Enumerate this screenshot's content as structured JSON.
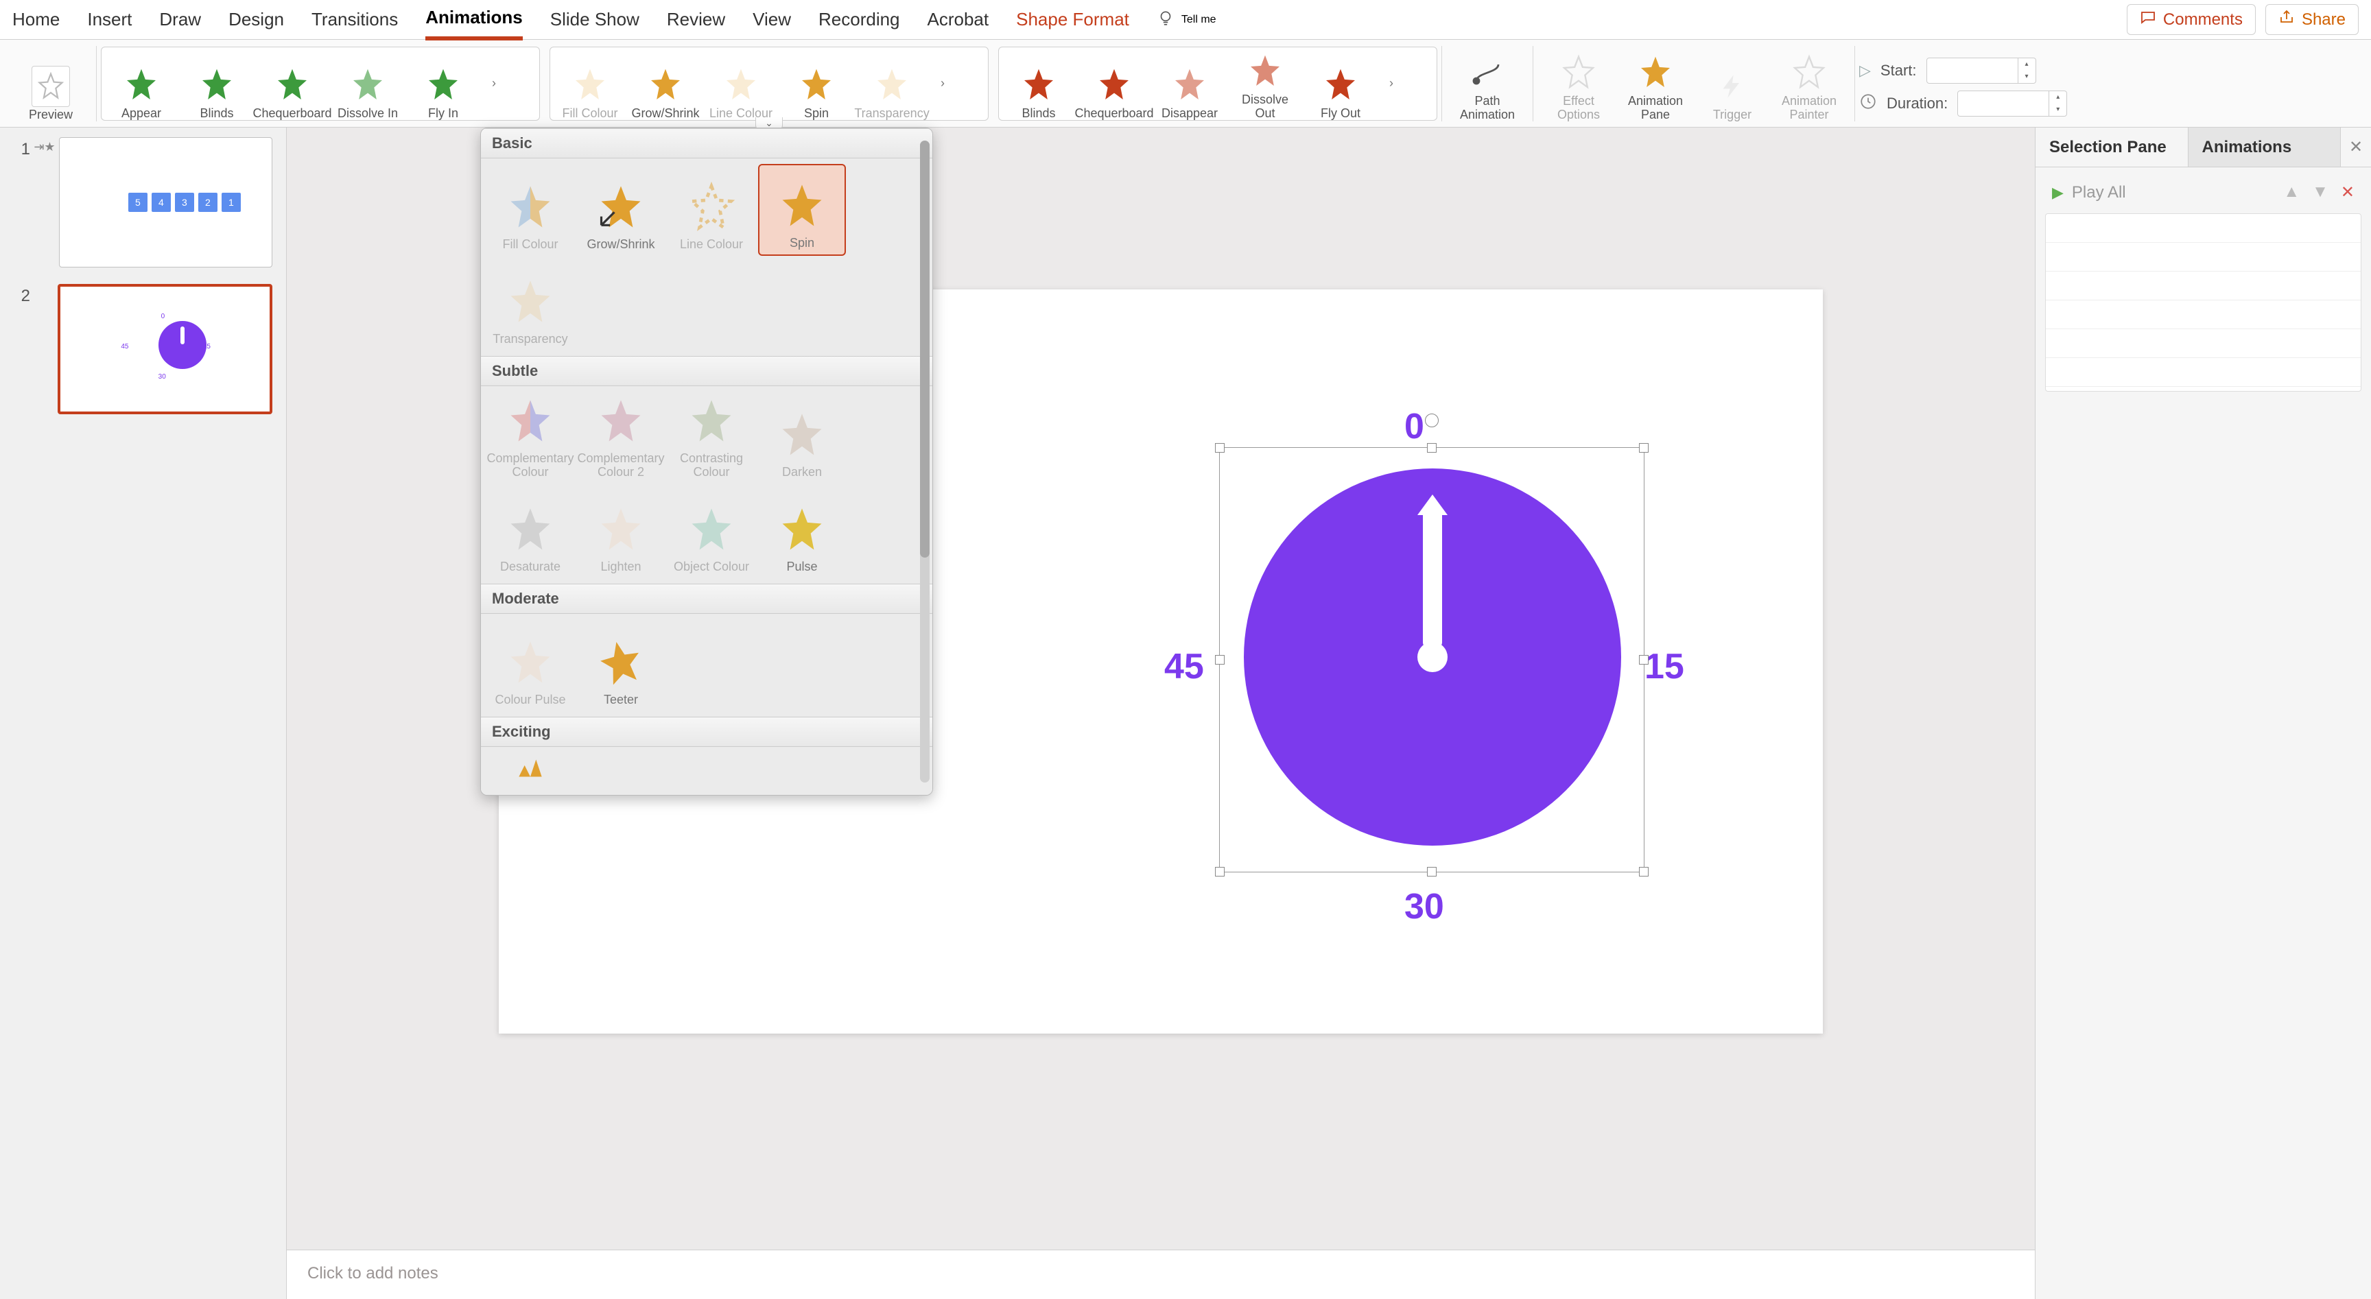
{
  "menu": {
    "tabs": [
      "Home",
      "Insert",
      "Draw",
      "Design",
      "Transitions",
      "Animations",
      "Slide Show",
      "Review",
      "View",
      "Recording",
      "Acrobat",
      "Shape Format"
    ],
    "active": "Animations",
    "tellme": "Tell me",
    "comments": "Comments",
    "share": "Share"
  },
  "ribbon": {
    "preview": "Preview",
    "entrance": [
      {
        "label": "Appear",
        "color": "#3c9a3c"
      },
      {
        "label": "Blinds",
        "color": "#3c9a3c"
      },
      {
        "label": "Chequerboard",
        "color": "#3c9a3c"
      },
      {
        "label": "Dissolve In",
        "color": "#3c9a3c"
      },
      {
        "label": "Fly In",
        "color": "#3c9a3c"
      }
    ],
    "emphasis": [
      {
        "label": "Fill Colour",
        "color": "#e0a030",
        "dim": true
      },
      {
        "label": "Grow/Shrink",
        "color": "#e0a030"
      },
      {
        "label": "Line Colour",
        "color": "#e0a030",
        "dim": true
      },
      {
        "label": "Spin",
        "color": "#e0a030"
      },
      {
        "label": "Transparency",
        "color": "#e0a030",
        "dim": true
      }
    ],
    "exit": [
      {
        "label": "Blinds",
        "color": "#c43e1c"
      },
      {
        "label": "Chequerboard",
        "color": "#c43e1c"
      },
      {
        "label": "Disappear",
        "color": "#c43e1c"
      },
      {
        "label": "Dissolve Out",
        "color": "#c43e1c"
      },
      {
        "label": "Fly Out",
        "color": "#c43e1c"
      }
    ],
    "path_animation": "Path Animation",
    "effect_options": "Effect Options",
    "animation_pane": "Animation Pane",
    "trigger": "Trigger",
    "animation_painter": "Animation Painter",
    "start_label": "Start:",
    "duration_label": "Duration:"
  },
  "dropdown": {
    "sections": {
      "basic": "Basic",
      "subtle": "Subtle",
      "moderate": "Moderate",
      "exciting": "Exciting"
    },
    "basic": [
      {
        "label": "Fill Colour",
        "dim": true
      },
      {
        "label": "Grow/Shrink"
      },
      {
        "label": "Line Colour",
        "dim": true
      },
      {
        "label": "Spin",
        "selected": true
      },
      {
        "label": "Transparency",
        "dim": true
      }
    ],
    "subtle": [
      {
        "label": "Complementary Colour",
        "dim": true
      },
      {
        "label": "Complementary Colour 2",
        "dim": true
      },
      {
        "label": "Contrasting Colour",
        "dim": true
      },
      {
        "label": "Darken",
        "dim": true
      },
      {
        "label": "Desaturate",
        "dim": true
      },
      {
        "label": "Lighten",
        "dim": true
      },
      {
        "label": "Object Colour",
        "dim": true
      },
      {
        "label": "Pulse"
      }
    ],
    "moderate": [
      {
        "label": "Colour Pulse",
        "dim": true
      },
      {
        "label": "Teeter"
      }
    ]
  },
  "thumbnails": {
    "slides": [
      "1",
      "2"
    ],
    "selected": "2",
    "s1_boxes": [
      "5",
      "4",
      "3",
      "2",
      "1"
    ]
  },
  "slide": {
    "clock": {
      "n0": "0",
      "n15": "15",
      "n30": "30",
      "n45": "45"
    }
  },
  "notes": {
    "placeholder": "Click to add notes"
  },
  "right_panel": {
    "tab1": "Selection Pane",
    "tab2": "Animations",
    "play_all": "Play All"
  }
}
